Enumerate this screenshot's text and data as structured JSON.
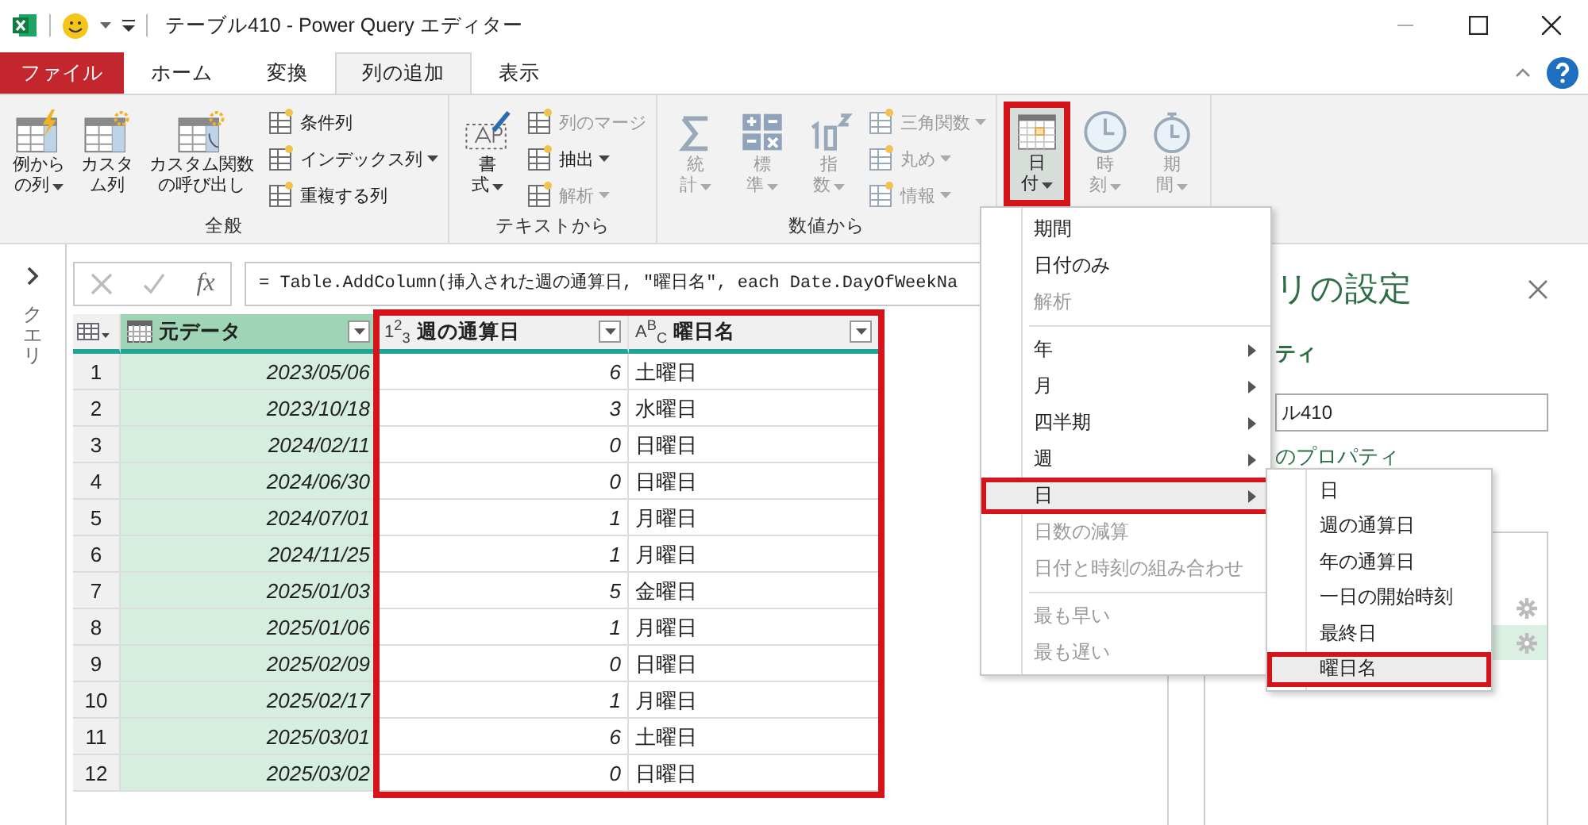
{
  "window": {
    "title": "テーブル410 - Power Query エディター"
  },
  "tabs": [
    {
      "label": "ファイル",
      "kind": "file",
      "selected": false
    },
    {
      "label": "ホーム",
      "kind": "tab",
      "selected": false
    },
    {
      "label": "変換",
      "kind": "tab",
      "selected": false
    },
    {
      "label": "列の追加",
      "kind": "tab",
      "selected": true
    },
    {
      "label": "表示",
      "kind": "tab",
      "selected": false
    }
  ],
  "ribbon": {
    "groups": [
      {
        "label": "全般",
        "large": [
          {
            "lines": [
              "例から",
              "の列"
            ],
            "dropdown": true,
            "disabled": false,
            "open": false,
            "highlighted": false
          },
          {
            "lines": [
              "カスタ",
              "ム列"
            ],
            "dropdown": false,
            "disabled": false,
            "open": false,
            "highlighted": false
          },
          {
            "lines": [
              "カスタム関数",
              "の呼び出し"
            ],
            "dropdown": false,
            "disabled": false,
            "open": false,
            "highlighted": false
          }
        ],
        "small": [
          {
            "label": "条件列",
            "dropdown": false,
            "disabled": false
          },
          {
            "label": "インデックス列",
            "dropdown": true,
            "disabled": false
          },
          {
            "label": "重複する列",
            "dropdown": false,
            "disabled": false
          }
        ]
      },
      {
        "label": "テキストから",
        "large": [
          {
            "lines": [
              "書",
              "式"
            ],
            "dropdown": true,
            "disabled": false,
            "open": false,
            "highlighted": false
          }
        ],
        "small": [
          {
            "label": "列のマージ",
            "dropdown": false,
            "disabled": true
          },
          {
            "label": "抽出",
            "dropdown": true,
            "disabled": false
          },
          {
            "label": "解析",
            "dropdown": true,
            "disabled": true
          }
        ]
      },
      {
        "label": "数値から",
        "large": [
          {
            "lines": [
              "統",
              "計"
            ],
            "dropdown": true,
            "disabled": true,
            "open": false,
            "highlighted": false
          },
          {
            "lines": [
              "標",
              "準"
            ],
            "dropdown": true,
            "disabled": true,
            "open": false,
            "highlighted": false
          },
          {
            "lines": [
              "指",
              "数"
            ],
            "dropdown": true,
            "disabled": true,
            "open": false,
            "highlighted": false
          }
        ],
        "small": [
          {
            "label": "三角関数",
            "dropdown": true,
            "disabled": true
          },
          {
            "label": "丸め",
            "dropdown": true,
            "disabled": true
          },
          {
            "label": "情報",
            "dropdown": true,
            "disabled": true
          }
        ]
      },
      {
        "large": [
          {
            "lines": [
              "日",
              "付"
            ],
            "dropdown": true,
            "disabled": false,
            "open": true,
            "highlighted": true
          },
          {
            "lines": [
              "時",
              "刻"
            ],
            "dropdown": true,
            "disabled": true,
            "open": false,
            "highlighted": false
          },
          {
            "lines": [
              "期",
              "間"
            ],
            "dropdown": true,
            "disabled": true,
            "open": false,
            "highlighted": false
          }
        ]
      }
    ]
  },
  "query_pane": {
    "label": "クエリ"
  },
  "formula_bar": {
    "fx_label": "fx",
    "formula": "= Table.AddColumn(挿入された週の通算日, \"曜日名\", each Date.DayOfWeekNa"
  },
  "table": {
    "columns": [
      {
        "label": "元データ",
        "kind": "date",
        "selected": true,
        "highlighted": false
      },
      {
        "label": "週の通算日",
        "kind": "number",
        "type_label": "1$^{2}$$_{3}$",
        "selected": false,
        "highlighted": true
      },
      {
        "label": "曜日名",
        "kind": "text",
        "type_label": "A$^{B}$$_{C}$",
        "selected": false,
        "highlighted": true
      }
    ],
    "rows": [
      {
        "index": "1",
        "cells": [
          "2023/05/06",
          "6",
          "土曜日"
        ]
      },
      {
        "index": "2",
        "cells": [
          "2023/10/18",
          "3",
          "水曜日"
        ]
      },
      {
        "index": "3",
        "cells": [
          "2024/02/11",
          "0",
          "日曜日"
        ]
      },
      {
        "index": "4",
        "cells": [
          "2024/06/30",
          "0",
          "日曜日"
        ]
      },
      {
        "index": "5",
        "cells": [
          "2024/07/01",
          "1",
          "月曜日"
        ]
      },
      {
        "index": "6",
        "cells": [
          "2024/11/25",
          "1",
          "月曜日"
        ]
      },
      {
        "index": "7",
        "cells": [
          "2025/01/03",
          "5",
          "金曜日"
        ]
      },
      {
        "index": "8",
        "cells": [
          "2025/01/06",
          "1",
          "月曜日"
        ]
      },
      {
        "index": "9",
        "cells": [
          "2025/02/09",
          "0",
          "日曜日"
        ]
      },
      {
        "index": "10",
        "cells": [
          "2025/02/17",
          "1",
          "月曜日"
        ]
      },
      {
        "index": "11",
        "cells": [
          "2025/03/01",
          "6",
          "土曜日"
        ]
      },
      {
        "index": "12",
        "cells": [
          "2025/03/02",
          "0",
          "日曜日"
        ]
      }
    ]
  },
  "settings_pane": {
    "title": "リの設定",
    "section": "ティ",
    "name_value": "ル410",
    "link": "のプロパティ",
    "steps": [
      {
        "selected": false
      },
      {
        "selected": true
      }
    ]
  },
  "menu": {
    "sections": [
      [
        {
          "label": "期間",
          "disabled": false,
          "submenu": false,
          "selected": false,
          "highlighted": false
        },
        {
          "label": "日付のみ",
          "disabled": false,
          "submenu": false,
          "selected": false,
          "highlighted": false
        },
        {
          "label": "解析",
          "disabled": true,
          "submenu": false,
          "selected": false,
          "highlighted": false
        }
      ],
      [
        {
          "label": "年",
          "disabled": false,
          "submenu": true,
          "selected": false,
          "highlighted": false
        },
        {
          "label": "月",
          "disabled": false,
          "submenu": true,
          "selected": false,
          "highlighted": false
        },
        {
          "label": "四半期",
          "disabled": false,
          "submenu": true,
          "selected": false,
          "highlighted": false
        },
        {
          "label": "週",
          "disabled": false,
          "submenu": true,
          "selected": false,
          "highlighted": false
        },
        {
          "label": "日",
          "disabled": false,
          "submenu": true,
          "selected": true,
          "highlighted": true
        },
        {
          "label": "日数の減算",
          "disabled": true,
          "submenu": false,
          "selected": false,
          "highlighted": false
        },
        {
          "label": "日付と時刻の組み合わせ",
          "disabled": true,
          "submenu": false,
          "selected": false,
          "highlighted": false
        }
      ],
      [
        {
          "label": "最も早い",
          "disabled": true,
          "submenu": false,
          "selected": false,
          "highlighted": false
        },
        {
          "label": "最も遅い",
          "disabled": true,
          "submenu": false,
          "selected": false,
          "highlighted": false
        }
      ]
    ]
  },
  "submenu": {
    "items": [
      {
        "label": "日",
        "selected": false,
        "highlighted": false
      },
      {
        "label": "週の通算日",
        "selected": false,
        "highlighted": false
      },
      {
        "label": "年の通算日",
        "selected": false,
        "highlighted": false
      },
      {
        "label": "一日の開始時刻",
        "selected": false,
        "highlighted": false
      },
      {
        "label": "最終日",
        "selected": false,
        "highlighted": false
      },
      {
        "label": "曜日名",
        "selected": true,
        "highlighted": true
      }
    ]
  }
}
